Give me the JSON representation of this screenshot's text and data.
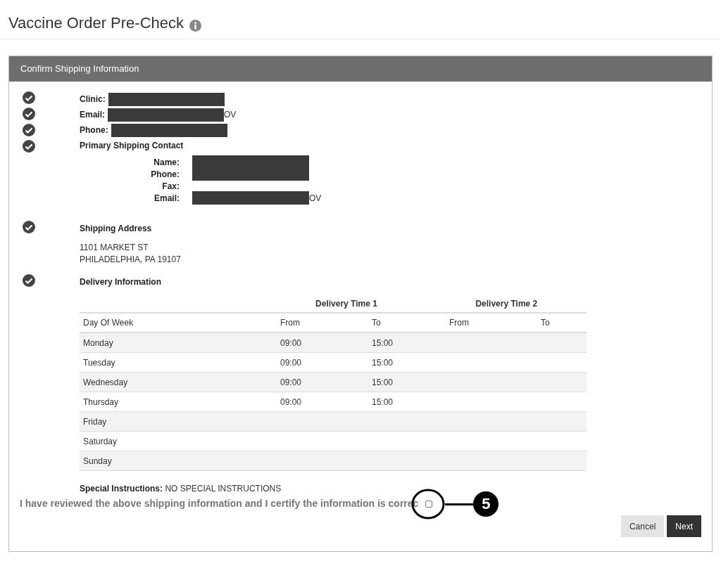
{
  "page_title": "Vaccine Order Pre-Check",
  "panel_title": "Confirm Shipping Information",
  "clinic": {
    "label": "Clinic:"
  },
  "email": {
    "label": "Email:",
    "suffix": "OV"
  },
  "phone": {
    "label": "Phone:"
  },
  "contact": {
    "heading": "Primary Shipping Contact",
    "fields": [
      {
        "label": "Name:",
        "redacted": true
      },
      {
        "label": "Phone:",
        "redacted": true
      },
      {
        "label": "Fax:",
        "redacted": false
      },
      {
        "label": "Email:",
        "redacted": true,
        "suffix": "OV"
      }
    ]
  },
  "address": {
    "heading": "Shipping Address",
    "lines": [
      "1101 MARKET ST",
      "PHILADELPHIA, PA 19107"
    ]
  },
  "delivery": {
    "heading": "Delivery Information",
    "groups": [
      "Delivery Time 1",
      "Delivery Time 2"
    ],
    "columns": [
      "Day Of Week",
      "From",
      "To",
      "From",
      "To"
    ],
    "rows": [
      [
        "Monday",
        "09:00",
        "15:00",
        "",
        ""
      ],
      [
        "Tuesday",
        "09:00",
        "15:00",
        "",
        ""
      ],
      [
        "Wednesday",
        "09:00",
        "15:00",
        "",
        ""
      ],
      [
        "Thursday",
        "09:00",
        "15:00",
        "",
        ""
      ],
      [
        "Friday",
        "",
        "",
        "",
        ""
      ],
      [
        "Saturday",
        "",
        "",
        "",
        ""
      ],
      [
        "Sunday",
        "",
        "",
        "",
        ""
      ]
    ]
  },
  "special": {
    "label": "Special Instructions:",
    "value": "NO SPECIAL INSTRUCTIONS"
  },
  "certify": {
    "text": "I have reviewed the above shipping information and I certify the information is correc",
    "checked": false
  },
  "callout": "5",
  "buttons": [
    {
      "label": "Cancel",
      "kind": "secondary"
    },
    {
      "label": "Next",
      "kind": "primary"
    }
  ]
}
